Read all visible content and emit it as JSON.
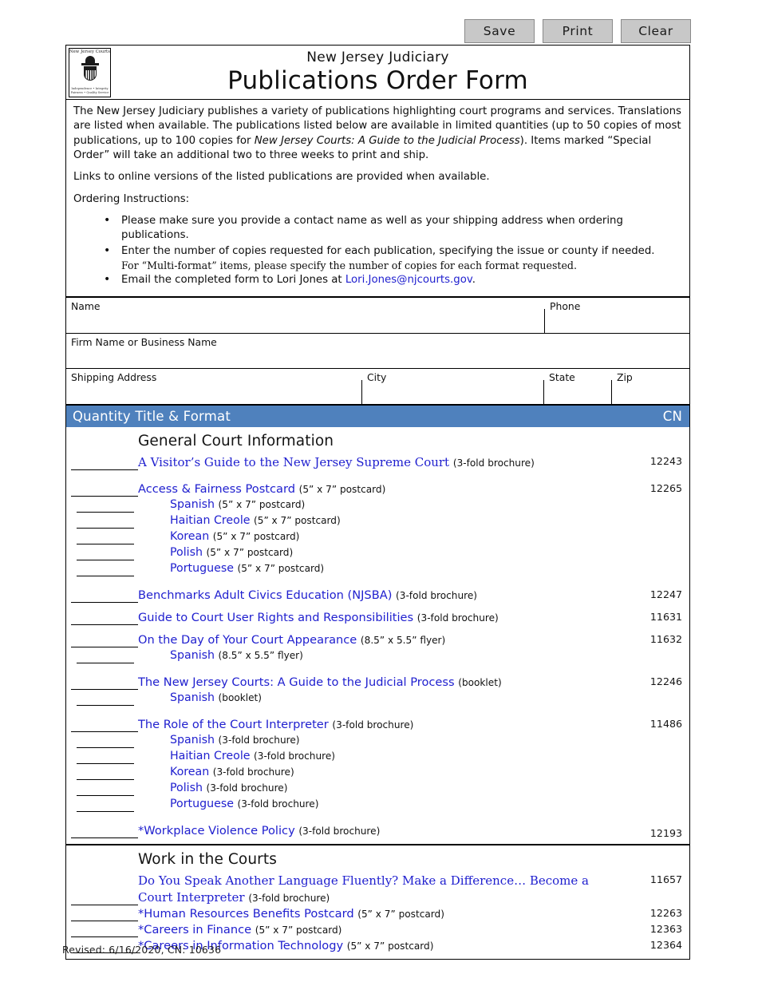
{
  "toolbar": {
    "save_label": "Save",
    "print_label": "Print",
    "clear_label": "Clear"
  },
  "header": {
    "logo_top": "New Jersey Courts",
    "logo_tagline_top": "Independence • Integrity",
    "logo_tagline_bottom": "Fairness • Quality Service",
    "subtitle": "New Jersey Judiciary",
    "title": "Publications Order Form"
  },
  "intro": {
    "para1_a": "The New Jersey Judiciary publishes a variety of publications highlighting court programs and services.  Translations are listed when available.  The publications listed below are available in limited quantities (up to 50 copies of most publications, up to 100 copies for ",
    "para1_italic": "New Jersey Courts: A Guide to the Judicial Process",
    "para1_b": ").  Items marked “Special Order” will take an additional two to three weeks to print and ship.",
    "para2": "Links to online versions of the listed publications are provided when available.",
    "para3": "Ordering Instructions:",
    "bullet1": "Please make sure you provide a contact name as well as your shipping address when ordering publications.",
    "bullet2": "Enter the number of copies requested for each publication, specifying the issue or county if needed.",
    "bullet2_sub": "For “Multi-format” items, please specify the number of copies for each format requested.",
    "bullet3_a": "Email the completed form to Lori Jones at ",
    "bullet3_link": "Lori.Jones@njcourts.gov",
    "bullet3_b": "."
  },
  "fields": {
    "name_label": "Name",
    "name_value": "",
    "phone_label": "Phone",
    "phone_value": "",
    "firm_label": "Firm Name or Business Name",
    "firm_value": "",
    "address_label": "Shipping Address",
    "address_value": "",
    "city_label": "City",
    "city_value": "",
    "state_label": "State",
    "state_value": "",
    "zip_label": "Zip",
    "zip_value": ""
  },
  "table": {
    "header_left": "Quantity Title & Format",
    "header_right": "CN",
    "accent_color": "#4f81bd",
    "link_color": "#2020cf",
    "sections": [
      {
        "title": "General Court Information",
        "rows": [
          {
            "level": 1,
            "serif": true,
            "title": "A Visitor’s Guide to the New Jersey Supreme Court",
            "format": "(3-fold brochure)",
            "cn": "12243",
            "quantity": "",
            "gap_after": "gap"
          },
          {
            "level": 1,
            "serif": false,
            "title": "Access & Fairness Postcard",
            "format": "(5” x 7” postcard)",
            "cn": "12265",
            "quantity": "",
            "gap_after": ""
          },
          {
            "level": 2,
            "serif": false,
            "title": "Spanish",
            "format": "(5” x 7” postcard)",
            "cn": "",
            "quantity": "",
            "gap_after": ""
          },
          {
            "level": 2,
            "serif": false,
            "title": "Haitian Creole",
            "format": "(5” x 7” postcard)",
            "cn": "",
            "quantity": "",
            "gap_after": ""
          },
          {
            "level": 2,
            "serif": false,
            "title": "Korean",
            "format": "(5” x 7” postcard)",
            "cn": "",
            "quantity": "",
            "gap_after": ""
          },
          {
            "level": 2,
            "serif": false,
            "title": "Polish",
            "format": "(5” x 7” postcard)",
            "cn": "",
            "quantity": "",
            "gap_after": ""
          },
          {
            "level": 2,
            "serif": false,
            "title": "Portuguese",
            "format": "(5” x 7” postcard)",
            "cn": "",
            "quantity": "",
            "gap_after": "gap"
          },
          {
            "level": 1,
            "serif": false,
            "title": "Benchmarks Adult Civics Education (NJSBA)",
            "format": "(3-fold brochure)",
            "cn": "12247",
            "quantity": "",
            "gap_after": "gap-sm"
          },
          {
            "level": 1,
            "serif": false,
            "title": "Guide to Court User Rights and Responsibilities",
            "format": "(3-fold brochure)",
            "cn": "11631",
            "quantity": "",
            "gap_after": "gap-sm"
          },
          {
            "level": 1,
            "serif": false,
            "title": "On the Day of Your Court Appearance",
            "format": "(8.5” x 5.5” flyer)",
            "cn": "11632",
            "quantity": "",
            "gap_after": ""
          },
          {
            "level": 2,
            "serif": false,
            "title": "Spanish",
            "format": "(8.5” x 5.5” flyer)",
            "cn": "",
            "quantity": "",
            "gap_after": "gap"
          },
          {
            "level": 1,
            "serif": false,
            "title": "The New Jersey Courts: A Guide to the Judicial Process",
            "format": "(booklet)",
            "cn": "12246",
            "quantity": "",
            "gap_after": ""
          },
          {
            "level": 2,
            "serif": false,
            "title": "Spanish",
            "format": "(booklet)",
            "cn": "",
            "quantity": "",
            "gap_after": "gap"
          },
          {
            "level": 1,
            "serif": false,
            "title": "The Role of the Court Interpreter",
            "format": "(3-fold brochure)",
            "cn": "11486",
            "quantity": "",
            "gap_after": ""
          },
          {
            "level": 2,
            "serif": false,
            "title": "Spanish",
            "format": "(3-fold brochure)",
            "cn": "",
            "quantity": "",
            "gap_after": ""
          },
          {
            "level": 2,
            "serif": false,
            "title": "Haitian Creole",
            "format": "(3-fold brochure)",
            "cn": "",
            "quantity": "",
            "gap_after": ""
          },
          {
            "level": 2,
            "serif": false,
            "title": "Korean",
            "format": "(3-fold brochure)",
            "cn": "",
            "quantity": "",
            "gap_after": ""
          },
          {
            "level": 2,
            "serif": false,
            "title": "Polish",
            "format": "(3-fold brochure)",
            "cn": "",
            "quantity": "",
            "gap_after": ""
          },
          {
            "level": 2,
            "serif": false,
            "title": "Portuguese",
            "format": "(3-fold brochure)",
            "cn": "",
            "quantity": "",
            "gap_after": "gap"
          },
          {
            "level": 1,
            "serif": false,
            "title": "*Workplace Violence Policy",
            "format": "(3-fold brochure)",
            "cn": "12193",
            "cn_low": true,
            "quantity": "",
            "gap_after": ""
          }
        ]
      },
      {
        "title": "Work in the Courts",
        "rows": [
          {
            "level": 1,
            "serif": true,
            "title": "Do You Speak Another Language Fluently? Make a Difference… Become a Court Interpreter",
            "format": "(3-fold brochure)",
            "cn": "11657",
            "quantity": "",
            "gap_after": ""
          },
          {
            "level": 1,
            "serif": false,
            "title": "*Human Resources Benefits Postcard",
            "format": "(5” x 7” postcard)",
            "cn": "12263",
            "quantity": "",
            "gap_after": ""
          },
          {
            "level": 1,
            "serif": false,
            "title": "*Careers in Finance",
            "format": "(5” x 7” postcard)",
            "cn": "12363",
            "quantity": "",
            "gap_after": ""
          },
          {
            "level": 1,
            "serif": false,
            "title": "*Careers in Information Technology",
            "format": "(5” x 7” postcard)",
            "cn": "12364",
            "quantity": "",
            "gap_after": ""
          }
        ]
      }
    ]
  },
  "footer": {
    "revised": "Revised: 6/16/2020, CN: 10636"
  }
}
